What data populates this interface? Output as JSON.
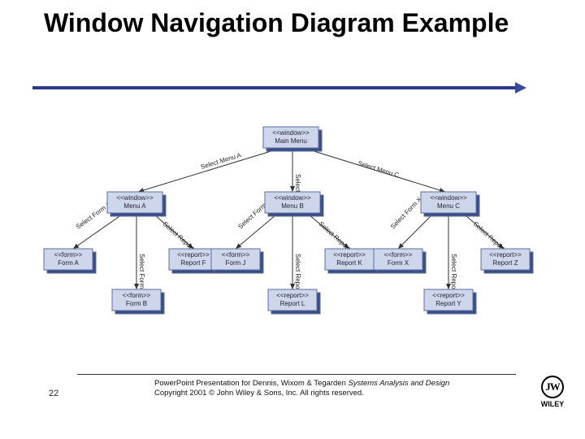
{
  "slide": {
    "title": "Window Navigation Diagram Example",
    "page_number": "22"
  },
  "footer": {
    "line1_prefix": "PowerPoint Presentation for Dennis, Wixom & Tegarden ",
    "book_title": "Systems Analysis and Design",
    "line2": "Copyright 2001 © John Wiley & Sons, Inc. All rights reserved.",
    "publisher": "WILEY"
  },
  "diagram": {
    "nodes": {
      "root": {
        "stereo": "<<window>>",
        "name": "Main Menu"
      },
      "menuA": {
        "stereo": "<<window>>",
        "name": "Menu A"
      },
      "menuB": {
        "stereo": "<<window>>",
        "name": "Menu B"
      },
      "menuC": {
        "stereo": "<<window>>",
        "name": "Menu C"
      },
      "formA": {
        "stereo": "<<form>>",
        "name": "Form A"
      },
      "formB": {
        "stereo": "<<form>>",
        "name": "Form B"
      },
      "reportF": {
        "stereo": "<<report>>",
        "name": "Report F"
      },
      "formJ": {
        "stereo": "<<form>>",
        "name": "Form J"
      },
      "reportK": {
        "stereo": "<<report>>",
        "name": "Report K"
      },
      "reportL": {
        "stereo": "<<report>>",
        "name": "Report L"
      },
      "formX": {
        "stereo": "<<form>>",
        "name": "Form X"
      },
      "reportY": {
        "stereo": "<<report>>",
        "name": "Report Y"
      },
      "reportZ": {
        "stereo": "<<report>>",
        "name": "Report Z"
      }
    },
    "edges": {
      "root_menuA": "Select Menu A",
      "root_menuB": "Select Menu B",
      "root_menuC": "Select Menu C",
      "menuA_formA": "Select Form A",
      "menuA_formB": "Select Form B",
      "menuA_reportF": "Select Report F",
      "menuB_formJ": "Select Form J",
      "menuB_reportK": "Select Report K",
      "menuB_reportL": "Select Report L",
      "menuC_formX": "Select Form X",
      "menuC_reportY": "Select Report Y",
      "menuC_reportZ": "Select Report Z"
    }
  }
}
